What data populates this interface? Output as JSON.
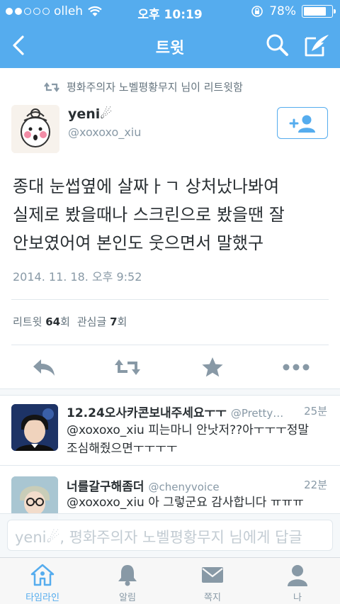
{
  "status_bar": {
    "carrier": "olleh",
    "time": "오후 10:19",
    "battery": "78%",
    "battery_level": 0.78
  },
  "nav": {
    "title": "트윗",
    "back_icon": "chevron-left-icon",
    "search_icon": "search-icon",
    "compose_icon": "compose-icon"
  },
  "retweet_header": {
    "text": "평화주의자 노벨평황무지 님이 리트윗함"
  },
  "tweet": {
    "user_name": "yeni☄",
    "user_handle": "@xoxoxo_xiu",
    "lines": [
      "종대 눈썹옆에 살짜ㅏㄱ 상처났나봐여",
      "실제로 봤을때나 스크린으로 봤을땐 잘",
      "안보였어여 본인도 웃으면서 말했구"
    ],
    "timestamp": "2014. 11. 18. 오후 9:52",
    "stats": {
      "retweet_label": "리트윗",
      "retweet_count": "64",
      "retweet_unit": "회",
      "like_label": "관심글",
      "like_count": "7",
      "like_unit": "회"
    }
  },
  "replies": [
    {
      "name": "12.24오사카콘보내주세요ㅜㅜ",
      "handle": "@Pretty…",
      "time": "25분",
      "lines": [
        "@xoxoxo_xiu 피는마니 안낫저??아ㅜㅜㅜ정말",
        "조심해줬으면ㅜㅜㅜㅜ"
      ]
    },
    {
      "name": "너를갈구해좀더",
      "handle": "@chenyvoice",
      "time": "22분",
      "lines": [
        "@xoxoxo_xiu 아 그렇군요 감사합니다 ㅠㅠㅠ"
      ]
    }
  ],
  "reply_bar": {
    "placeholder": "yeni☄, 평화주의자 노벨평황무지 님에게 답글"
  },
  "tabs": [
    {
      "label": "타임라인",
      "icon": "home-icon",
      "active": true
    },
    {
      "label": "알림",
      "icon": "bell-icon",
      "active": false
    },
    {
      "label": "쪽지",
      "icon": "envelope-icon",
      "active": false
    },
    {
      "label": "나",
      "icon": "person-icon",
      "active": false
    }
  ],
  "colors": {
    "brand": "#55acee",
    "text": "#292f33",
    "muted": "#8899a6",
    "action_icon": "#8899a6"
  }
}
